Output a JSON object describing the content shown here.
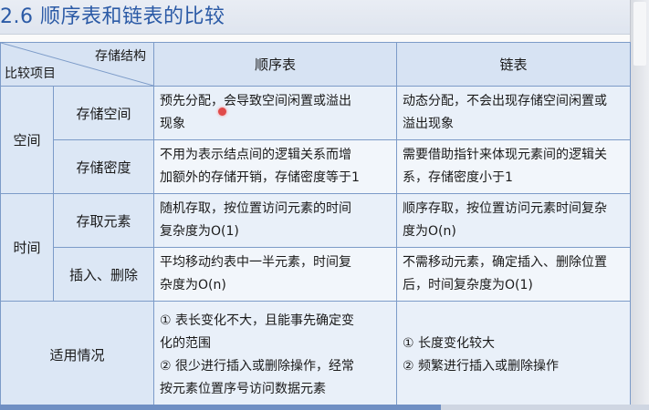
{
  "slide": {
    "title": "2.6 顺序表和链表的比较"
  },
  "table": {
    "corner_top": "存储结构",
    "corner_bottom": "比较项目",
    "col_seq": "顺序表",
    "col_link": "链表",
    "rows": [
      {
        "category": "空间",
        "sub": "存储空间",
        "seq": [
          "预先分配，会导致空间闲置或溢出",
          "现象"
        ],
        "link": [
          "动态分配，不会出现存储空间闲置或",
          "溢出现象"
        ]
      },
      {
        "sub": "存储密度",
        "seq": [
          "不用为表示结点间的逻辑关系而增",
          "加额外的存储开销，存储密度等于1"
        ],
        "link": [
          "需要借助指针来体现元素间的逻辑关",
          "系，存储密度小于1"
        ]
      },
      {
        "category": "时间",
        "sub": "存取元素",
        "seq": [
          "随机存取，按位置访问元素的时间",
          "复杂度为O(1)"
        ],
        "link": [
          "顺序存取，按位置访问元素时间复杂",
          "度为O(n)"
        ]
      },
      {
        "sub": "插入、删除",
        "seq": [
          "平均移动约表中一半元素，时间复",
          "杂度为O(n)"
        ],
        "link": [
          "不需移动元素，确定插入、删除位置",
          "后，时间复杂度为O(1)"
        ]
      }
    ],
    "usage": {
      "label": "适用情况",
      "seq": [
        "① 表长变化不大，且能事先确定变",
        "化的范围",
        "② 很少进行插入或删除操作，经常",
        "按元素位置序号访问数据元素"
      ],
      "link": [
        "① 长度变化较大",
        "② 频繁进行插入或删除操作"
      ]
    }
  },
  "colors": {
    "title": "#2b5aa6",
    "border": "#7c9bc8",
    "header_bg": "#d7e3f3",
    "cell_bg": "#e9f0f9",
    "cursor": "#e04a4a"
  },
  "progress": {
    "fraction": 0.68
  }
}
